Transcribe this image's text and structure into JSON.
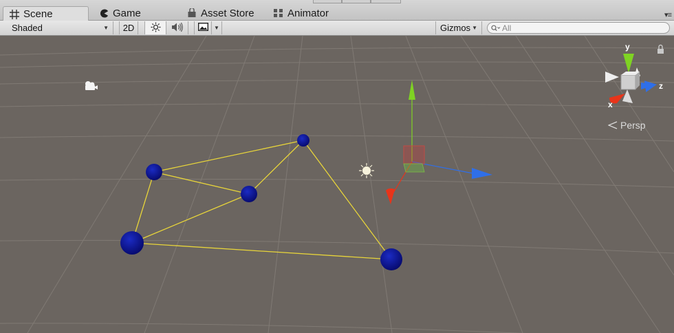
{
  "tabs": [
    {
      "label": "Scene",
      "icon": "grid-icon",
      "active": true
    },
    {
      "label": "Game",
      "icon": "pacman-icon",
      "active": false
    },
    {
      "label": "Asset Store",
      "icon": "store-icon",
      "active": false
    },
    {
      "label": "Animator",
      "icon": "animator-icon",
      "active": false
    }
  ],
  "toolbar": {
    "draw_mode": "Shaded",
    "mode_2d": "2D",
    "lighting_icon": "sun-icon",
    "audio_icon": "speaker-icon",
    "effects_icon": "image-icon",
    "gizmos": "Gizmos",
    "search_placeholder": "All"
  },
  "gizmo": {
    "y_label": "y",
    "z_label": "z",
    "x_label": "x",
    "projection": "Persp"
  },
  "colors": {
    "background": "#6b6560",
    "sphere": "#0c1696",
    "line": "#e8d53a",
    "axis_y": "#7fd323",
    "axis_x": "#e8341a",
    "axis_z": "#2f6fe8"
  }
}
